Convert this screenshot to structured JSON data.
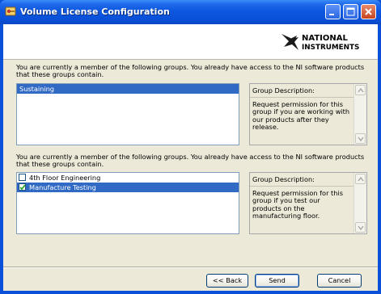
{
  "window": {
    "title": "Volume License Configuration",
    "icons": {
      "app": "key-app-icon",
      "minimize": "minimize-icon",
      "maximize": "maximize-icon",
      "close": "close-icon"
    }
  },
  "logo": {
    "line1": "NATIONAL",
    "line2": "INSTRUMENTS",
    "icon": "ni-eagle-logo"
  },
  "section1": {
    "intro": "You are currently a member of the following groups. You already have access to the NI software products that these groups contain.",
    "items": [
      {
        "label": "Sustaining",
        "selected": true
      }
    ],
    "description_header": "Group Description:",
    "description": "Request permission for this group if you are working with our products after they release."
  },
  "section2": {
    "intro": "You are currently a member of the following groups. You already have access to the NI software products that these groups contain.",
    "items": [
      {
        "label": "4th Floor Engineering",
        "checked": false,
        "selected": false
      },
      {
        "label": "Manufacture Testing",
        "checked": true,
        "selected": true
      }
    ],
    "description_header": "Group Description:",
    "description": "Request permission for this group if you test our products on the manufacturing floor."
  },
  "buttons": {
    "back": "<< Back",
    "send": "Send",
    "cancel": "Cancel"
  },
  "colors": {
    "title_bar": "#0a50d8",
    "selection": "#316ac5",
    "client_bg": "#ece9d8"
  }
}
